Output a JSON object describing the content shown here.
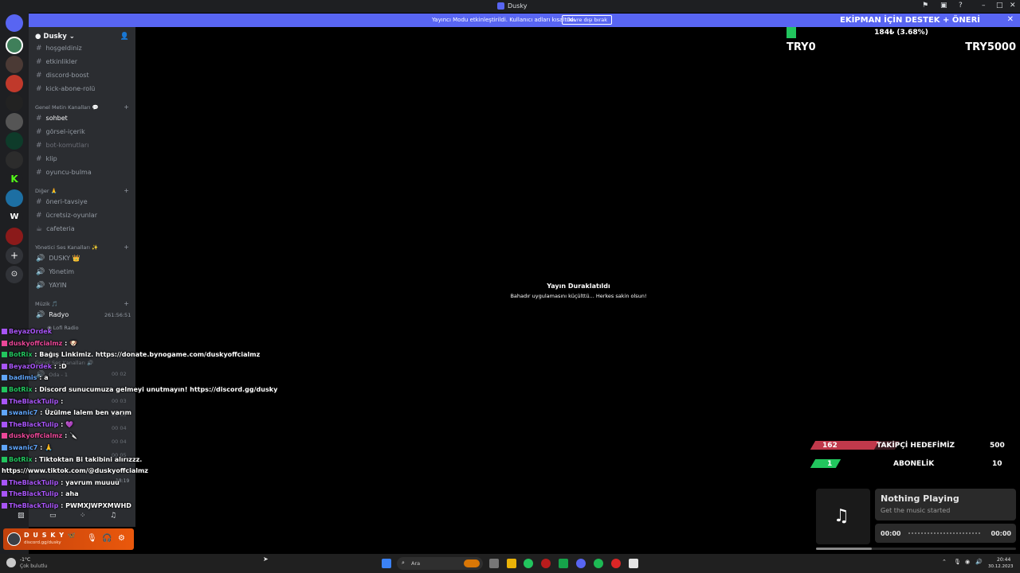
{
  "window": {
    "title": "Dusky"
  },
  "banner": {
    "message": "Yayıncı Modu etkinleştirildi. Kullanıcı adları kısaltıldı.",
    "disable_label": "Devre dışı bırak",
    "promo": "EKİPMAN İÇİN DESTEK + ÖNERİ"
  },
  "server": {
    "name": "Dusky"
  },
  "channels": {
    "top": [
      "hoşgeldiniz",
      "etkinlikler",
      "discord-boost",
      "kick-abone-rolü"
    ],
    "cat_general_text": "Genel Metin Kanalları 💬",
    "general_text": [
      "sohbet",
      "görsel-içerik",
      "bot-komutları",
      "klip",
      "oyuncu-bulma"
    ],
    "cat_other": "Diğer 🙏",
    "other": [
      "öneri-tavsiye",
      "ücretsiz-oyunlar",
      "cafeteria"
    ],
    "cat_admin_voice": "Yönetici Ses Kanalları ✨",
    "admin_voice": [
      "DUSKY 👑",
      "Yönetim",
      "YAYIN"
    ],
    "cat_music": "Müzik 🎵",
    "radio": "Radyo",
    "radio_time": "261:56:51",
    "radio_user": "Lofi Radio",
    "cat_general_voice": "Genel Ses Kanalları 🔊",
    "rooms": [
      {
        "name": "Oda - 1",
        "a": "00",
        "b": "02"
      },
      {
        "name": "Oda - 3",
        "a": "00",
        "b": "03"
      },
      {
        "name": "Oda - 5",
        "a": "00",
        "b": "04"
      },
      {
        "name": "Oda - 6",
        "a": "00",
        "b": "04"
      },
      {
        "name": "Oda - 7",
        "a": "00",
        "b": "05"
      }
    ],
    "voice_time": "18:19"
  },
  "user": {
    "name": "D U S K Y 🦋",
    "status": "discord.gg/dusky"
  },
  "chat": [
    {
      "user": "BeyazOrdek",
      "text": "",
      "color": "#a855f7"
    },
    {
      "user": "duskyoffcialmz",
      "text": ": 🐶",
      "color": "#ec4899"
    },
    {
      "user": "BotRix",
      "text": ": Bağış Linkimiz. https://donate.bynogame.com/duskyoffcialmz",
      "color": "#22c55e"
    },
    {
      "user": "BeyazOrdek",
      "text": ": :D",
      "color": "#a855f7"
    },
    {
      "user": "badimis",
      "text": ": a",
      "color": "#60a5fa"
    },
    {
      "user": "BotRix",
      "text": ": Discord sunucumuza gelmeyi unutmayın! https://discord.gg/dusky",
      "color": "#22c55e"
    },
    {
      "user": "TheBlackTulip",
      "text": ":",
      "color": "#a855f7"
    },
    {
      "user": "swanic7",
      "text": ": Üzülme lalem ben varım",
      "color": "#60a5fa"
    },
    {
      "user": "TheBlackTulip",
      "text": ": 💜",
      "color": "#a855f7"
    },
    {
      "user": "duskyoffcialmz",
      "text": ": 🔪",
      "color": "#ec4899"
    },
    {
      "user": "swanic7",
      "text": ": 🙏",
      "color": "#60a5fa"
    },
    {
      "user": "BotRix",
      "text": ": Tiktoktan Bi takibini alırızzz.",
      "color": "#22c55e"
    },
    {
      "user": "",
      "text": "https://www.tiktok.com/@duskyoffcialmz",
      "color": "#ffffff"
    },
    {
      "user": "TheBlackTulip",
      "text": ": yavrum muuuu",
      "color": "#a855f7"
    },
    {
      "user": "TheBlackTulip",
      "text": ": aha",
      "color": "#a855f7"
    },
    {
      "user": "TheBlackTulip",
      "text": ": PWMXJWPXMWHD",
      "color": "#a855f7"
    }
  ],
  "stream": {
    "paused_title": "Yayın Duraklatıldı",
    "paused_sub": "Bahadır uygulamasını küçülttü... Herkes sakin olsun!"
  },
  "donation": {
    "text": "184₺ (3.68%)",
    "progress": 0.0368,
    "min": "TRY0",
    "max": "TRY5000",
    "color": "#22c55e"
  },
  "goals": [
    {
      "value": "162",
      "label": "TAKİPÇİ HEDEFİMİZ",
      "target": "500",
      "progress": 0.324,
      "color": "#c0394b"
    },
    {
      "value": "1",
      "label": "ABONELİK",
      "target": "10",
      "progress": 0.1,
      "color": "#22c55e"
    }
  ],
  "music": {
    "title": "Nothing Playing",
    "subtitle": "Get the music started",
    "time_start": "00:00",
    "time_end": "00:00",
    "progress": 0.28
  },
  "taskbar": {
    "weather_temp": "-1°C",
    "weather_desc": "Çok bulutlu",
    "search": "Ara",
    "time": "20:44",
    "date": "30.12.2023"
  }
}
